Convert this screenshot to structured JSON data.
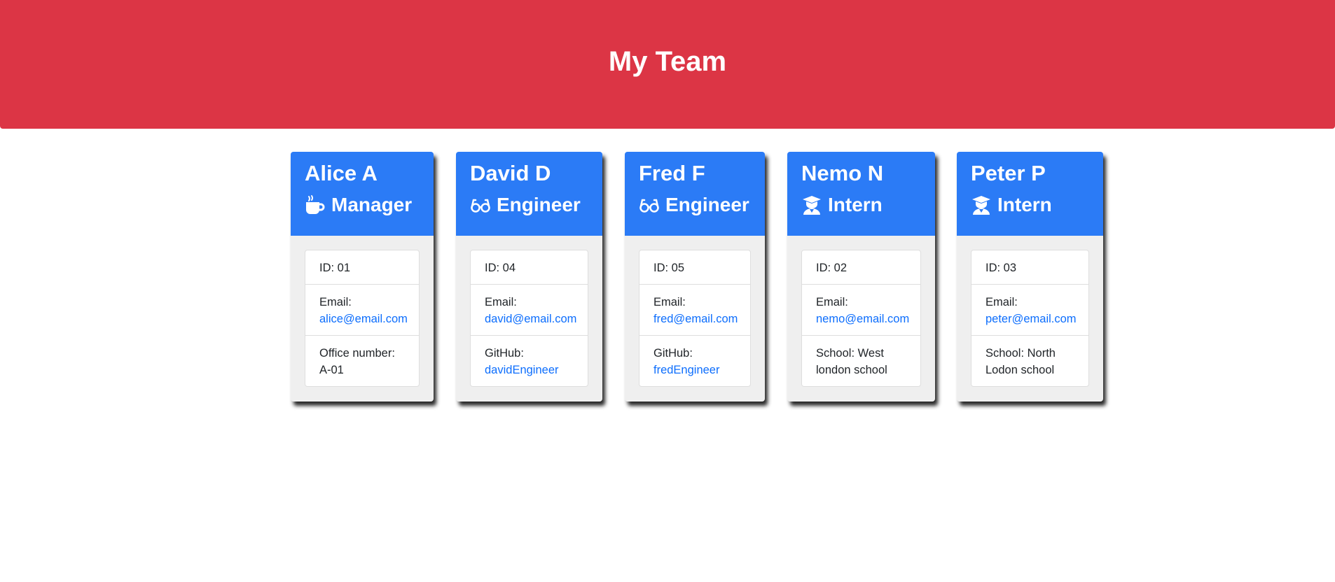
{
  "header": {
    "title": "My Team"
  },
  "cards": [
    {
      "name": "Alice A",
      "role": "Manager",
      "role_icon": "mug-icon",
      "id_text": "ID: 01",
      "email_label": "Email:",
      "email": "alice@email.com",
      "extra_label": "Office number:",
      "extra_value": "A-01"
    },
    {
      "name": "David D",
      "role": "Engineer",
      "role_icon": "glasses-icon",
      "id_text": "ID: 04",
      "email_label": "Email:",
      "email": "david@email.com",
      "extra_label": "GitHub:",
      "extra_value": "davidEngineer"
    },
    {
      "name": "Fred F",
      "role": "Engineer",
      "role_icon": "glasses-icon",
      "id_text": "ID: 05",
      "email_label": "Email:",
      "email": "fred@email.com",
      "extra_label": "GitHub:",
      "extra_value": "fredEngineer"
    },
    {
      "name": "Nemo N",
      "role": "Intern",
      "role_icon": "graduate-icon",
      "id_text": "ID: 02",
      "email_label": "Email:",
      "email": "nemo@email.com",
      "extra_label": "School: West",
      "extra_value": "london school"
    },
    {
      "name": "Peter P",
      "role": "Intern",
      "role_icon": "graduate-icon",
      "id_text": "ID: 03",
      "email_label": "Email:",
      "email": "peter@email.com",
      "extra_label": "School: North",
      "extra_value": "Lodon school"
    }
  ],
  "colors": {
    "header_bg": "#dc3545",
    "card_head_bg": "#2b7bf6",
    "link": "#0d6efd"
  }
}
